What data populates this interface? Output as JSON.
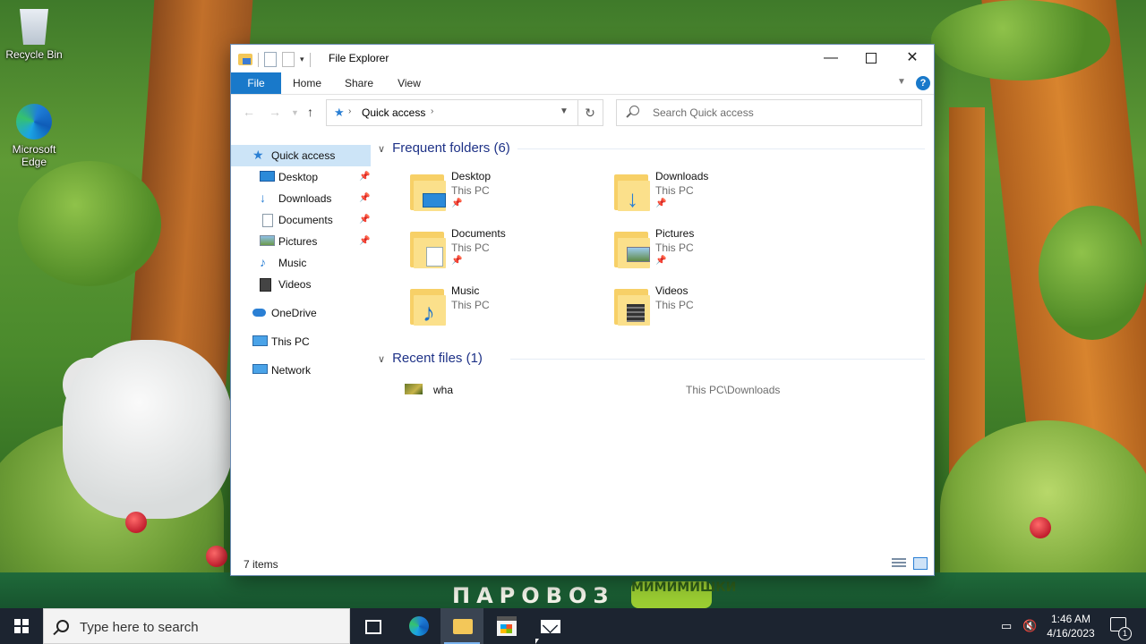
{
  "desktop": {
    "icons": [
      {
        "label": "Recycle Bin",
        "icon": "recycle-bin-icon"
      },
      {
        "label": "Microsoft Edge",
        "icon": "edge-icon"
      }
    ],
    "wallpaper_brand": {
      "left": "ПАРОВОЗ",
      "right": "МИМИМИШКИ"
    }
  },
  "window": {
    "title": "File Explorer",
    "ribbon_tabs": [
      "File",
      "Home",
      "Share",
      "View"
    ],
    "address": {
      "path": "Quick access",
      "search_placeholder": "Search Quick access"
    },
    "nav": [
      {
        "label": "Quick access",
        "icon": "star-icon",
        "selected": true
      },
      {
        "label": "Desktop",
        "icon": "desktop-icon",
        "pinned": true
      },
      {
        "label": "Downloads",
        "icon": "download-arrow-icon",
        "pinned": true
      },
      {
        "label": "Documents",
        "icon": "document-icon",
        "pinned": true
      },
      {
        "label": "Pictures",
        "icon": "pictures-icon",
        "pinned": true
      },
      {
        "label": "Music",
        "icon": "music-note-icon"
      },
      {
        "label": "Videos",
        "icon": "video-icon"
      },
      {
        "label": "OneDrive",
        "icon": "cloud-icon"
      },
      {
        "label": "This PC",
        "icon": "computer-icon"
      },
      {
        "label": "Network",
        "icon": "network-icon"
      }
    ],
    "frequent": {
      "heading": "Frequent folders (6)",
      "folders": [
        {
          "name": "Desktop",
          "location": "This PC",
          "pinned": true
        },
        {
          "name": "Downloads",
          "location": "This PC",
          "pinned": true
        },
        {
          "name": "Documents",
          "location": "This PC",
          "pinned": true
        },
        {
          "name": "Pictures",
          "location": "This PC",
          "pinned": true
        },
        {
          "name": "Music",
          "location": "This PC",
          "pinned": false
        },
        {
          "name": "Videos",
          "location": "This PC",
          "pinned": false
        }
      ]
    },
    "recent": {
      "heading": "Recent files (1)",
      "files": [
        {
          "name": "wha",
          "path": "This PC\\Downloads"
        }
      ]
    },
    "status": "7 items"
  },
  "taskbar": {
    "search_placeholder": "Type here to search",
    "time": "1:46 AM",
    "date": "4/16/2023",
    "notification_count": "1",
    "pinned_apps": [
      "task-view",
      "edge",
      "file-explorer",
      "microsoft-store",
      "mail"
    ],
    "active_app": "file-explorer"
  },
  "colors": {
    "accent": "#1979ca",
    "selection": "#cce4f7",
    "heading": "#1e3287",
    "taskbar": "#1c2430"
  }
}
